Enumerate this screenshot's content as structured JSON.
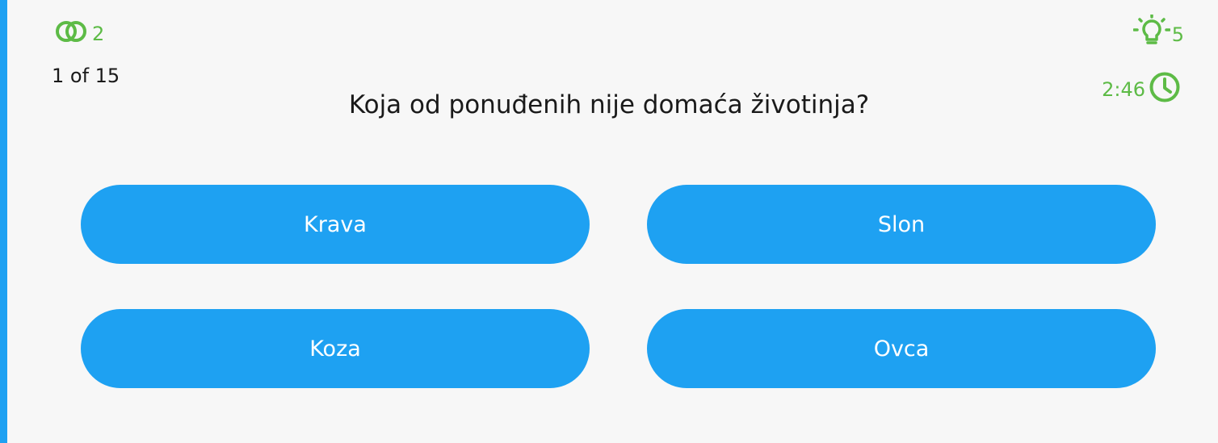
{
  "status": {
    "lives_count": "2",
    "progress": "1 of 15",
    "hints_count": "5",
    "time_left": "2:46"
  },
  "question": {
    "text": "Koja od ponuđenih nije domaća životinja?"
  },
  "answers": [
    {
      "label": "Krava"
    },
    {
      "label": "Slon"
    },
    {
      "label": "Koza"
    },
    {
      "label": "Ovca"
    }
  ],
  "colors": {
    "accent_blue": "#1ea1f2",
    "status_green": "#5dbb46",
    "background": "#f7f7f7",
    "text": "#1a1a1a"
  },
  "icons": {
    "lives": "double-circle-icon",
    "hints": "lightbulb-icon",
    "timer": "clock-icon"
  }
}
